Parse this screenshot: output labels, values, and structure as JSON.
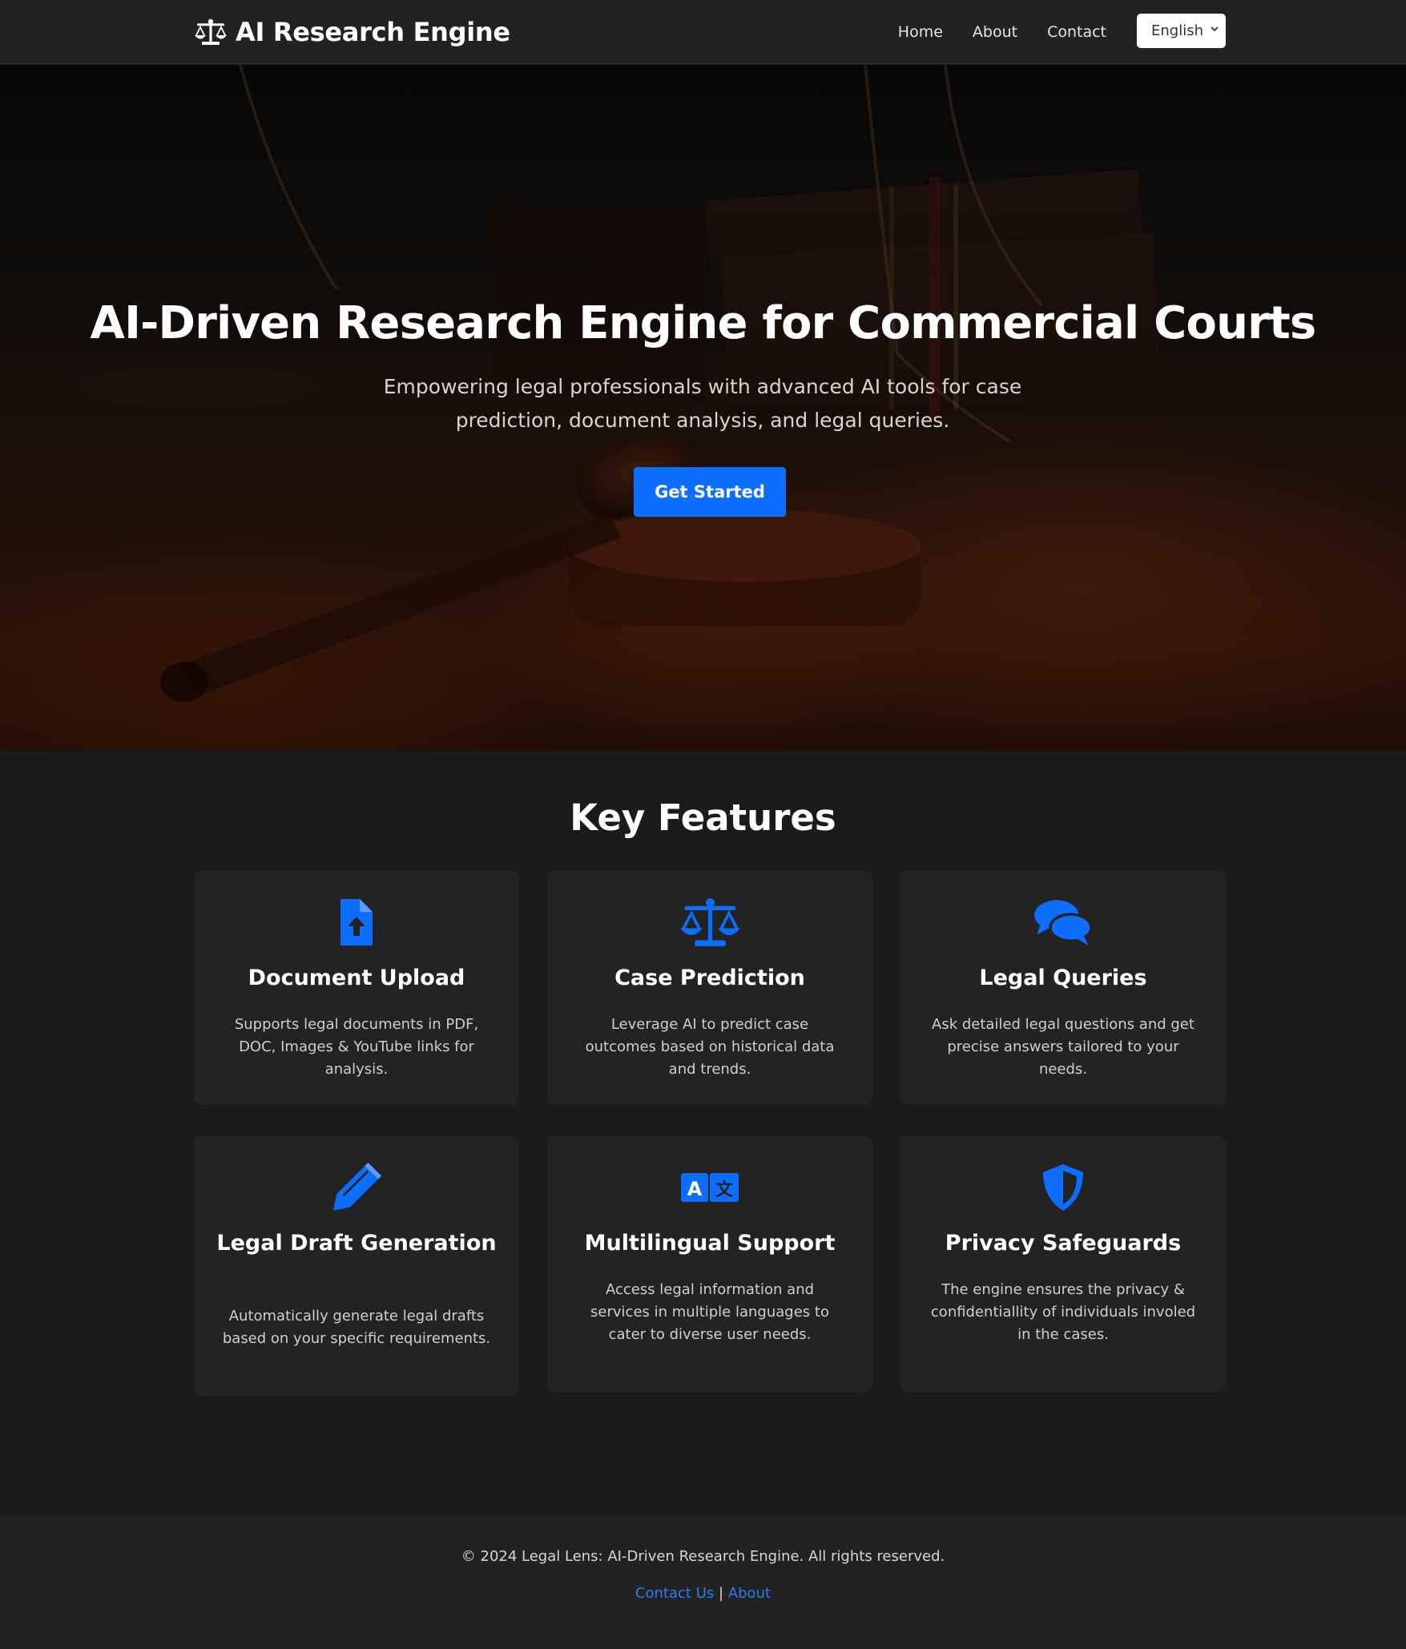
{
  "navbar": {
    "brand": "AI Research Engine",
    "brand_icon": "balance-scale-icon",
    "links": [
      "Home",
      "About",
      "Contact"
    ],
    "language": "English"
  },
  "hero": {
    "title": "AI-Driven Research Engine for Commercial Courts",
    "subtitle": "Empowering legal professionals with advanced AI tools for case prediction, document analysis, and legal queries.",
    "cta": "Get Started"
  },
  "features": {
    "heading": "Key Features",
    "accent_color": "#0d6efd",
    "items": [
      {
        "icon": "file-upload-icon",
        "title": "Document Upload",
        "description": "Supports legal documents in PDF, DOC, Images & YouTube links for analysis."
      },
      {
        "icon": "balance-scale-icon",
        "title": "Case Prediction",
        "description": "Leverage AI to predict case outcomes based on historical data and trends."
      },
      {
        "icon": "comments-icon",
        "title": "Legal Queries",
        "description": "Ask detailed legal questions and get precise answers tailored to your needs."
      },
      {
        "icon": "pencil-icon",
        "title": "Legal Draft Generation",
        "description": "Automatically generate legal drafts based on your specific requirements."
      },
      {
        "icon": "language-icon",
        "title": "Multilingual Support",
        "description": "Access legal information and services in multiple languages to cater to diverse user needs."
      },
      {
        "icon": "shield-icon",
        "title": "Privacy Safeguards",
        "description": "The engine ensures the privacy & confidentiallity of individuals involed in the cases."
      }
    ]
  },
  "footer": {
    "copyright": "© 2024 Legal Lens: AI-Driven Research Engine. All rights reserved.",
    "links": [
      "Contact Us",
      "About"
    ],
    "separator": "|"
  }
}
